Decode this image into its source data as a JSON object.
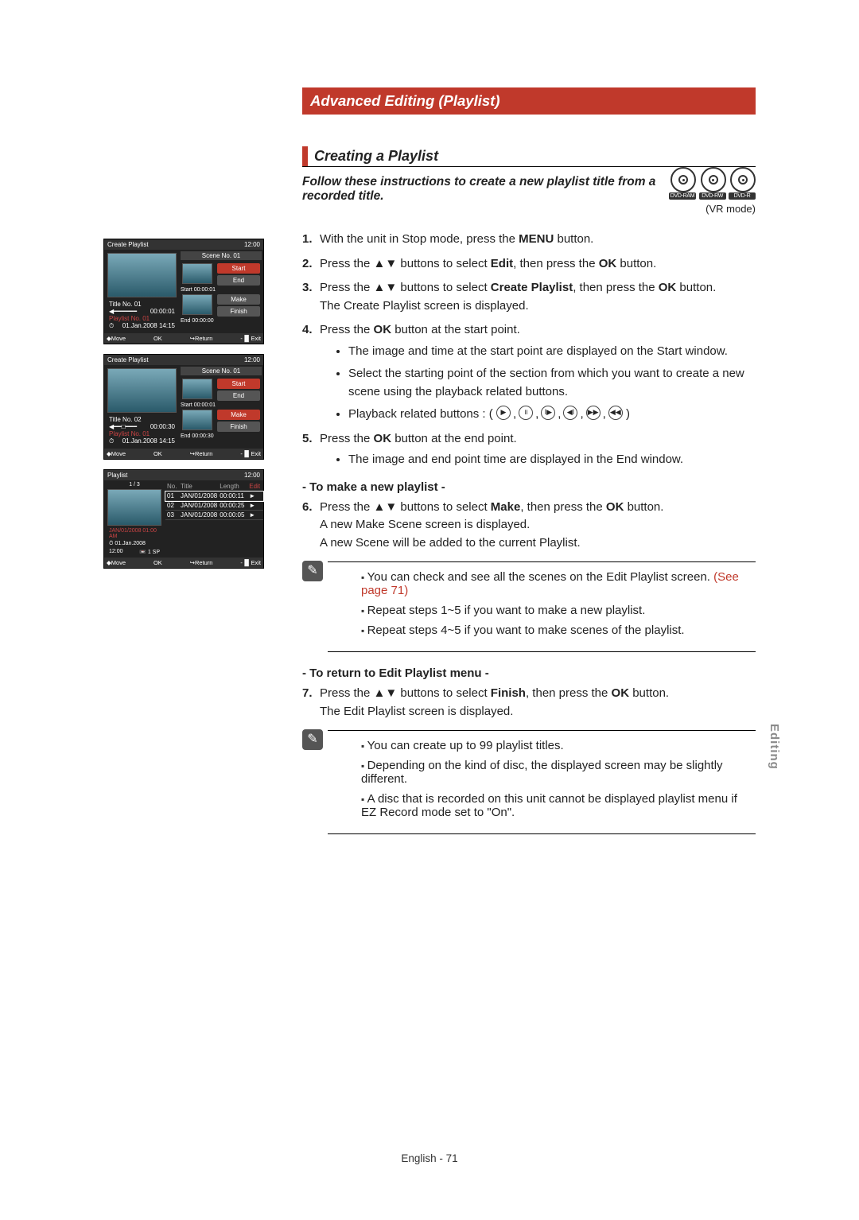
{
  "banner": "Advanced Editing (Playlist)",
  "h2": "Creating a Playlist",
  "intro": "Follow these instructions to create a new playlist title from a recorded title.",
  "discs": {
    "a": "DVD-RAM",
    "b": "DVD-RW",
    "c": "DVD-R",
    "mode": "(VR mode)"
  },
  "s1a": "With the unit in Stop mode, press the ",
  "s1menu": "MENU",
  "s1b": " button.",
  "s2a": "Press the  ▲▼ buttons to select ",
  "s2edit": "Edit",
  "s2b": ", then press the ",
  "s2ok": "OK",
  "s2c": " button.",
  "s3a": "Press the  ▲▼ buttons to select ",
  "s3cp": "Create Playlist",
  "s3b": ", then press the ",
  "s3ok": "OK",
  "s3c": " button.",
  "s3d": "The Create Playlist screen is displayed.",
  "s4a": "Press the ",
  "s4ok": "OK",
  "s4b": " button at the start point.",
  "s4sub1": "The image and time at the start point are displayed on the Start window.",
  "s4sub2": "Select the starting point of the section from which you want to create a new scene using the playback related buttons.",
  "s4sub3": "Playback related buttons : (",
  "s4sub3b": ")",
  "s5a": "Press the ",
  "s5ok": "OK",
  "s5b": " button at the end point.",
  "s5sub1": "The image and end point time are displayed in the End window.",
  "sub_make": "- To make a new playlist -",
  "s6a": "Press the  ▲▼ buttons to select ",
  "s6make": "Make",
  "s6b": ", then press the ",
  "s6ok": "OK",
  "s6c": " button.",
  "s6d": "A new Make Scene screen is displayed.",
  "s6e": "A new Scene will be added to the current Playlist.",
  "note1a": "You can check and see all the scenes on the Edit Playlist screen. ",
  "note1see": "(See page 71)",
  "note1b": "Repeat steps 1~5 if you want to make a new playlist.",
  "note1c": "Repeat steps 4~5 if you want to make scenes of the playlist.",
  "sub_return": "- To return to Edit Playlist menu -",
  "s7a": "Press the  ▲▼ buttons to select ",
  "s7fin": "Finish",
  "s7b": ", then press the ",
  "s7ok": "OK",
  "s7c": " button.",
  "s7d": "The Edit Playlist screen is displayed.",
  "note2a": "You can create up to 99 playlist titles.",
  "note2b": "Depending on the kind of disc, the displayed screen may be slightly different.",
  "note2c": "A disc that is recorded on this unit cannot be displayed playlist menu if EZ Record mode set to \"On\".",
  "sidetab": "Editing",
  "footer": "English - 71",
  "mock": {
    "cp": "Create Playlist",
    "pl": "Playlist",
    "time": "12:00",
    "scene": "Scene No. 01",
    "start": "Start",
    "end": "End",
    "make": "Make",
    "finish": "Finish",
    "start_t": "Start 00:00:01",
    "end_t0": "End 00:00:00",
    "end_t30": "End 00:00:30",
    "title01": "Title No. 01",
    "title02": "Title No. 02",
    "elapsed1": "00:00:01",
    "elapsed30": "00:00:30",
    "plno": "Playlist No. 01",
    "date": "01.Jan.2008 14:15",
    "move": "◆Move",
    "ok": "OK",
    "ret": "↪Return",
    "exit": "-▐▌Exit",
    "count": "1 / 3",
    "no": "No.",
    "ttl": "Title",
    "len": "Length",
    "ed": "Edit",
    "r1a": "01",
    "r1b": "JAN/01/2008",
    "r1c": "00:00:11",
    "r1d": "►",
    "r2a": "02",
    "r2b": "JAN/01/2008",
    "r2c": "00:00:25",
    "r2d": "►",
    "r3a": "03",
    "r3b": "JAN/01/2008",
    "r3c": "00:00:05",
    "r3d": "►",
    "tinfo": "JAN/01/2008 01:00 AM",
    "date2": "01.Jan.2008",
    "tsp": "12:00",
    "sp": "📼 1 SP"
  }
}
